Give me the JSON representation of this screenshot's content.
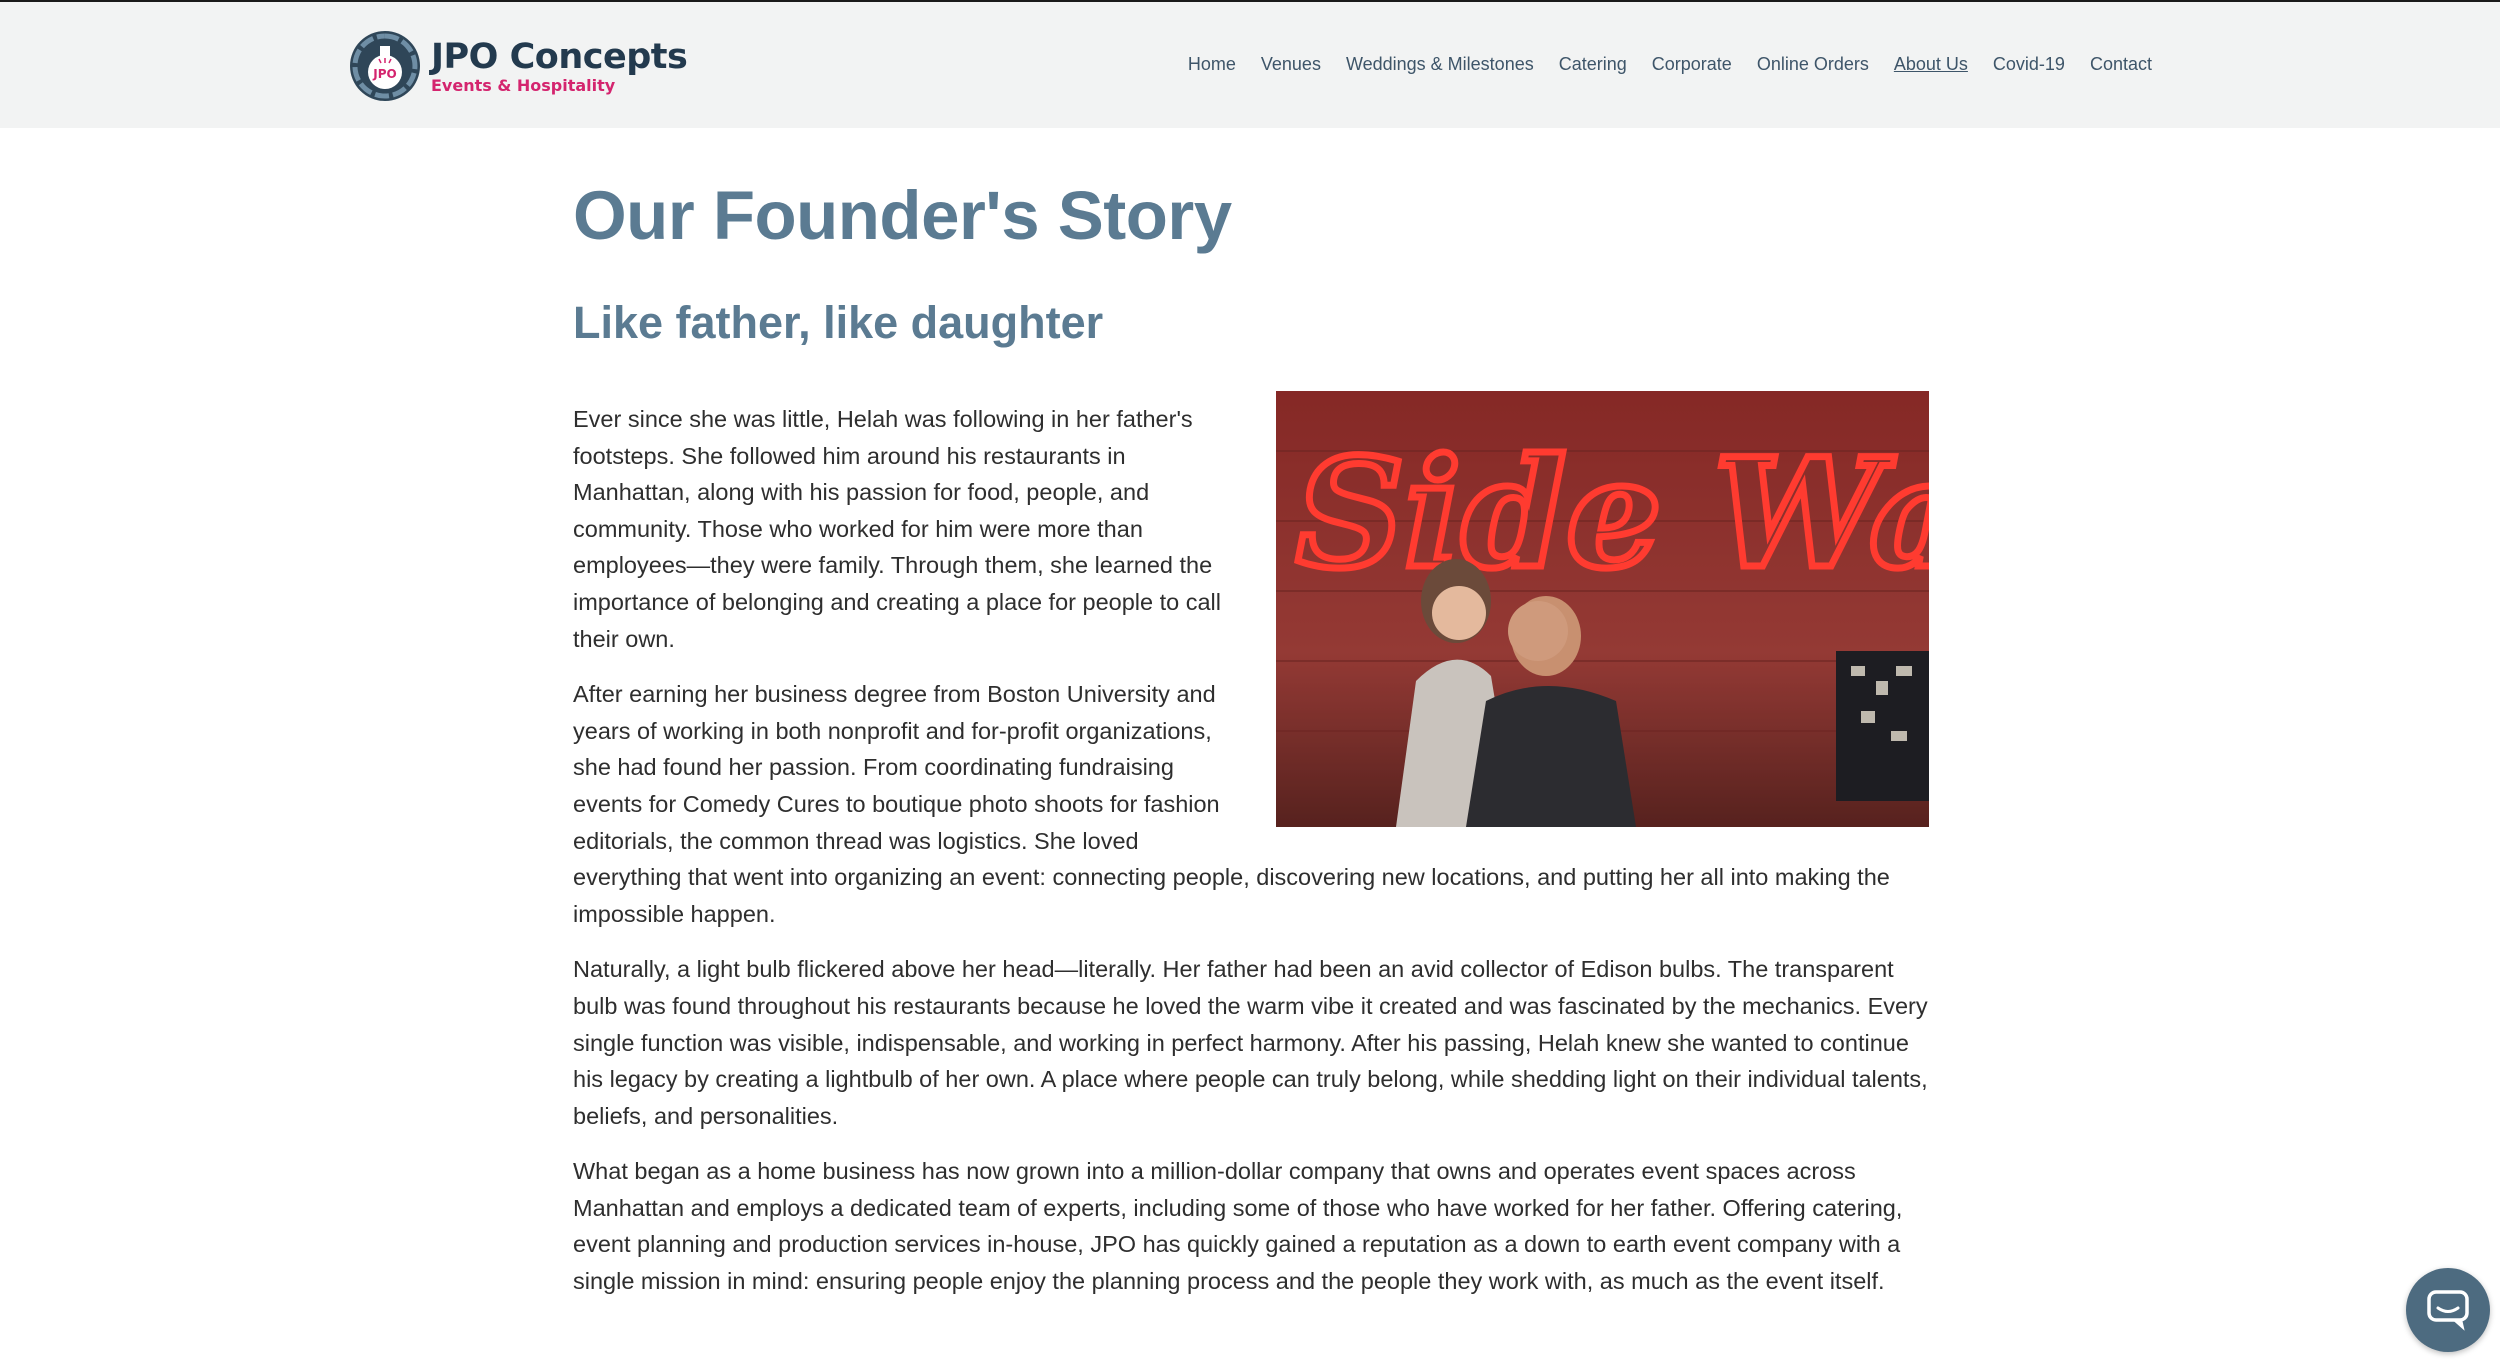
{
  "header": {
    "brand_name": "JPO Concepts",
    "brand_tagline": "Events & Hospitality",
    "logo_text": "JPO",
    "nav": [
      {
        "label": "Home",
        "active": false
      },
      {
        "label": "Venues",
        "active": false
      },
      {
        "label": "Weddings & Milestones",
        "active": false
      },
      {
        "label": "Catering",
        "active": false
      },
      {
        "label": "Corporate",
        "active": false
      },
      {
        "label": "Online Orders",
        "active": false
      },
      {
        "label": "About Us",
        "active": true
      },
      {
        "label": "Covid-19",
        "active": false
      },
      {
        "label": "Contact",
        "active": false
      }
    ]
  },
  "main": {
    "title": "Our Founder's Story",
    "subtitle": "Like father, like daughter",
    "photo_sign_text": "Side Walk",
    "paragraphs": [
      "Ever since she was little, Helah was following in her father's footsteps. She followed him around his restaurants in Manhattan, along with his passion for food, people, and community. Those who worked for him were more than employees—they were family. Through them, she learned the importance of belonging and creating a place for people to call their own.",
      "After earning her business degree from Boston University and years of working in both nonprofit and for-profit organizations, she had found her passion. From coordinating fundraising events for Comedy Cures to boutique photo shoots for fashion editorials, the common thread was logistics. She loved everything that went into organizing an event: connecting people, discovering new locations, and putting her all into making the impossible happen.",
      "Naturally, a light bulb flickered above her head—literally. Her father had been an avid collector of Edison bulbs. The transparent bulb was found throughout his restaurants because he loved the warm vibe it created and was fascinated by the mechanics. Every single function was visible, indispensable, and working in perfect harmony. After his passing, Helah knew she wanted to continue his legacy by creating a lightbulb of her own. A place where people can truly belong, while shedding light on their individual talents, beliefs, and personalities.",
      "What began as a home business has now grown into a million-dollar company that owns and operates event spaces across Manhattan and employs a dedicated team of experts, including some of those who have worked for her father. Offering catering, event planning and production services in-house, JPO has quickly gained a reputation as a down to earth event company with a single mission in mind: ensuring people enjoy the planning process and the people they work with, as much as the event itself."
    ]
  },
  "colors": {
    "brand_navy": "#233a4e",
    "brand_pink": "#d4246e",
    "heading": "#5b7b92",
    "nav_text": "#3e5569",
    "chat_bubble": "#4d6b80"
  },
  "chat_widget": {
    "icon": "chat-bubble-icon"
  }
}
